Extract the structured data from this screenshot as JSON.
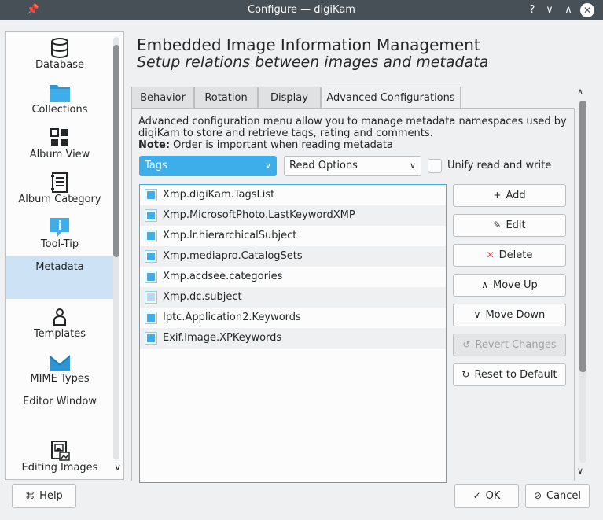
{
  "window": {
    "title": "Configure — digiKam"
  },
  "sidebar": {
    "items": [
      {
        "label": "Database",
        "icon": "database-icon"
      },
      {
        "label": "Collections",
        "icon": "folder-icon"
      },
      {
        "label": "Album View",
        "icon": "album-view-icon"
      },
      {
        "label": "Album Category",
        "icon": "album-category-icon"
      },
      {
        "label": "Tool-Tip",
        "icon": "tooltip-icon"
      },
      {
        "label": "Metadata",
        "icon": "metadata-icon",
        "selected": true
      },
      {
        "label": "Templates",
        "icon": "templates-icon"
      },
      {
        "label": "MIME Types",
        "icon": "mime-types-icon"
      },
      {
        "label": "Editor Window",
        "icon": "editor-window-icon"
      },
      {
        "label": "Editing Images",
        "icon": "editing-images-icon"
      }
    ]
  },
  "header": {
    "title": "Embedded Image Information Management",
    "subtitle": "Setup relations between images and metadata"
  },
  "tabs": [
    {
      "label": "Behavior"
    },
    {
      "label": "Rotation"
    },
    {
      "label": "Display"
    },
    {
      "label": "Advanced Configurations",
      "active": true
    }
  ],
  "advanced": {
    "description": "Advanced configuration menu allow you to manage metadata namespaces used by digiKam to store and retrieve tags, rating and comments.",
    "note_label": "Note:",
    "note_text": " Order is important when reading metadata",
    "type_combo": "Tags",
    "operation_combo": "Read Options",
    "unify_label": "Unify read and write",
    "unify_checked": false,
    "namespaces": [
      {
        "label": "Xmp.digiKam.TagsList",
        "checked": true
      },
      {
        "label": "Xmp.MicrosoftPhoto.LastKeywordXMP",
        "checked": true
      },
      {
        "label": "Xmp.lr.hierarchicalSubject",
        "checked": true
      },
      {
        "label": "Xmp.mediapro.CatalogSets",
        "checked": true
      },
      {
        "label": "Xmp.acdsee.categories",
        "checked": true
      },
      {
        "label": "Xmp.dc.subject",
        "checked": true,
        "dimmed": true
      },
      {
        "label": "Iptc.Application2.Keywords",
        "checked": true
      },
      {
        "label": "Exif.Image.XPKeywords",
        "checked": true
      }
    ],
    "buttons": {
      "add": "Add",
      "edit": "Edit",
      "delete": "Delete",
      "move_up": "Move Up",
      "move_down": "Move Down",
      "revert": "Revert Changes",
      "reset": "Reset to Default"
    }
  },
  "footer": {
    "help": "Help",
    "ok": "OK",
    "cancel": "Cancel"
  },
  "colors": {
    "accent": "#3daee9",
    "titlebar": "#475057",
    "window_bg": "#eff0f1",
    "selection": "#cde3f5",
    "delete_icon": "#da4453"
  }
}
